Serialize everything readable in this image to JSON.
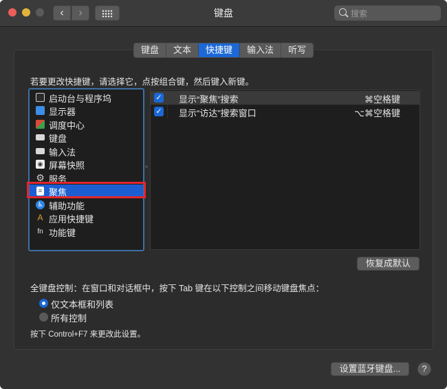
{
  "window": {
    "title": "键盘"
  },
  "search": {
    "placeholder": "搜索"
  },
  "tabs": [
    {
      "label": "键盘"
    },
    {
      "label": "文本"
    },
    {
      "label": "快捷键"
    },
    {
      "label": "输入法"
    },
    {
      "label": "听写"
    }
  ],
  "active_tab": "快捷键",
  "instruction": "若要更改快捷键，请选择它，点按组合键，然后键入新键。",
  "categories": [
    {
      "label": "启动台与程序坞",
      "icon": "launchpad-dock-icon"
    },
    {
      "label": "显示器",
      "icon": "display-icon"
    },
    {
      "label": "调度中心",
      "icon": "mission-control-icon"
    },
    {
      "label": "键盘",
      "icon": "keyboard-icon"
    },
    {
      "label": "输入法",
      "icon": "input-source-icon"
    },
    {
      "label": "屏幕快照",
      "icon": "screenshot-icon"
    },
    {
      "label": "服务",
      "icon": "gear-icon"
    },
    {
      "label": "聚焦",
      "icon": "spotlight-doc-icon"
    },
    {
      "label": "辅助功能",
      "icon": "accessibility-icon"
    },
    {
      "label": "应用快捷键",
      "icon": "app-shortcuts-icon"
    },
    {
      "label": "功能键",
      "icon": "fn-key-icon"
    }
  ],
  "selected_category": "聚焦",
  "shortcuts": [
    {
      "checked": true,
      "name": "显示“聚焦”搜索",
      "keys": "⌘空格键"
    },
    {
      "checked": true,
      "name": "显示“访达”搜索窗口",
      "keys": "⌥⌘空格键"
    }
  ],
  "restore_button": "恢复成默认",
  "full_keyboard_access": {
    "label": "全键盘控制：在窗口和对话框中，按下 Tab 键在以下控制之间移动键盘焦点：",
    "options": [
      {
        "label": "仅文本框和列表",
        "selected": true
      },
      {
        "label": "所有控制",
        "selected": false
      }
    ],
    "note": "按下 Control+F7 来更改此设置。"
  },
  "bluetooth_button": "设置蓝牙键盘...",
  "help_button": "?",
  "colors": {
    "accent": "#1c68d6",
    "highlight_box": "#e2252c",
    "window_bg": "#323232"
  }
}
